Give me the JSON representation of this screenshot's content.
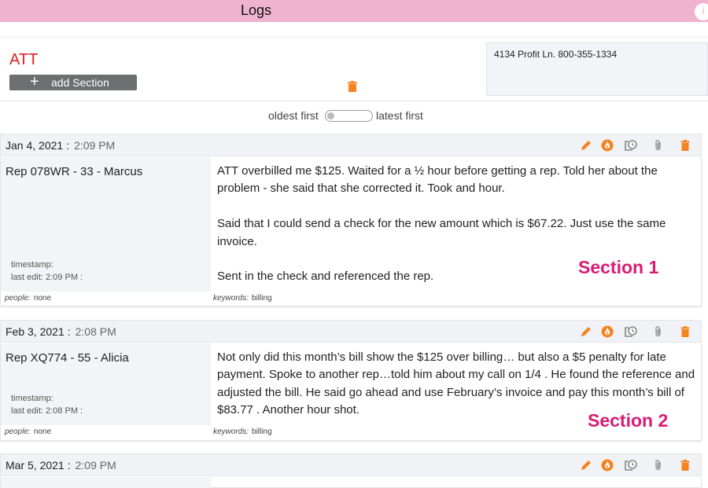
{
  "app": {
    "title": "Logs",
    "info_icon": "info-icon",
    "accent": "#f0b3cf"
  },
  "header": {
    "company": "ATT",
    "add_section_label": "add Section",
    "address": "4134 Profit Ln. 800-355-1334"
  },
  "sort": {
    "left_label": "oldest first",
    "right_label": "latest first",
    "latest_first": false
  },
  "sections": [
    {
      "date": "Jan 4, 2021",
      "time": "2:09 PM",
      "rep": "Rep 078WR - 33 - Marcus",
      "timestamp_label": "timestamp:",
      "last_edit": "last edit: 2:09 PM :",
      "notes": [
        "ATT overbilled me $125. Waited for a ½ hour before getting a rep. Told her about the problem - she said that she corrected it. Took and hour.",
        "Said that I could send a check for the new amount which is $67.22. Just use the same invoice.",
        "Sent in the check and referenced the rep."
      ],
      "people_label": "people:",
      "people": "none",
      "keywords_label": "keywords:",
      "keywords": "billing",
      "label": "Section 1"
    },
    {
      "date": "Feb 3, 2021",
      "time": "2:08 PM",
      "rep": "Rep XQ774 - 55 - Alicia",
      "timestamp_label": "timestamp:",
      "last_edit": "last edit: 2:08 PM :",
      "notes": [
        "Not only did this month’s bill show the $125 over billing… but also a $5 penalty for late payment. Spoke to another rep…told him about my call on 1/4 . He found the reference and adjusted the bill. He said go ahead and use February’s invoice and pay this month’s bill of $83.77 . Another hour shot."
      ],
      "people_label": "people:",
      "people": "none",
      "keywords_label": "keywords:",
      "keywords": "billing",
      "label": "Section 2"
    },
    {
      "date": "Mar 5, 2021",
      "time": "2:09 PM"
    }
  ],
  "icons": {
    "edit": "pencil-icon",
    "fire": "flame-icon",
    "history": "clock-icon",
    "attach": "paperclip-icon",
    "delete": "trash-icon"
  },
  "colors": {
    "icon_orange": "#f5831f",
    "icon_gray": "#888888",
    "company": "#e02020",
    "section_label": "#d81b74"
  }
}
